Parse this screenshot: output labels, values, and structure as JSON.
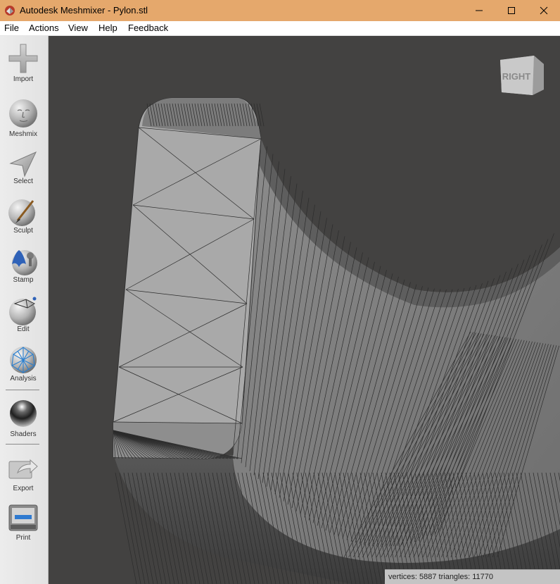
{
  "window": {
    "title": "Autodesk Meshmixer - Pylon.stl",
    "icon": "meshmixer-app-icon",
    "controls": [
      "minimize-icon",
      "maximize-icon",
      "close-icon"
    ]
  },
  "menu": {
    "file": "File",
    "actions": "Actions",
    "view": "View",
    "help": "Help",
    "feedback": "Feedback"
  },
  "toolbar": {
    "import": "Import",
    "meshmix": "Meshmix",
    "select": "Select",
    "sculpt": "Sculpt",
    "stamp": "Stamp",
    "edit": "Edit",
    "analysis": "Analysis",
    "shaders": "Shaders",
    "export": "Export",
    "print": "Print"
  },
  "viewport": {
    "navcube_face": "RIGHT",
    "status": "vertices: 5887 triangles: 11770",
    "background": "#434241"
  },
  "colors": {
    "titlebar": "#e5a86c",
    "mesh_light": "#a9a9a9",
    "mesh_mid": "#7e7e7e",
    "mesh_dark": "#5a5a5a"
  }
}
